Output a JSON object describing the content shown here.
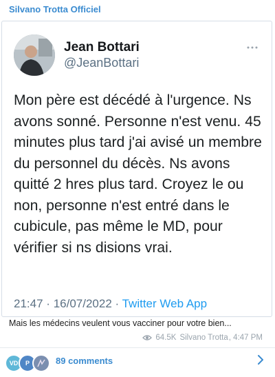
{
  "channel": {
    "name": "Silvano Trotta Officiel"
  },
  "tweet": {
    "author_name": "Jean Bottari",
    "author_handle": "@JeanBottari",
    "text": "Mon père est décédé à l'urgence. Ns avons sonné. Personne n'est venu. 45 minutes plus tard j'ai avisé un membre du personnel du décès. Ns avons quitté 2 hres plus tard. Croyez le ou non, personne n'est entré dans le cubicule, pas même le MD, pour vérifier si ns disions vrai.",
    "time": "21:47",
    "date": "16/07/2022",
    "separator": "·",
    "source": "Twitter Web App",
    "more_icon": "more-dots-icon"
  },
  "message": {
    "caption": "Mais les médecins veulent vous vacciner pour votre bien...",
    "views": "64.5K",
    "author": "Silvano Trotta",
    "time": "4:47 PM",
    "views_icon": "eye-icon"
  },
  "comments": {
    "avatars": [
      {
        "initials": "VD",
        "color": "#5fb8d8"
      },
      {
        "initials": "P",
        "color": "#4f86c6"
      },
      {
        "initials": "",
        "color": "#7b8fb0"
      }
    ],
    "label": "89 comments",
    "arrow_icon": "chevron-right-icon"
  },
  "colors": {
    "channel_accent": "#3a8bd0",
    "twitter_blue": "#1d9bf0",
    "muted": "#9aa4ad"
  }
}
